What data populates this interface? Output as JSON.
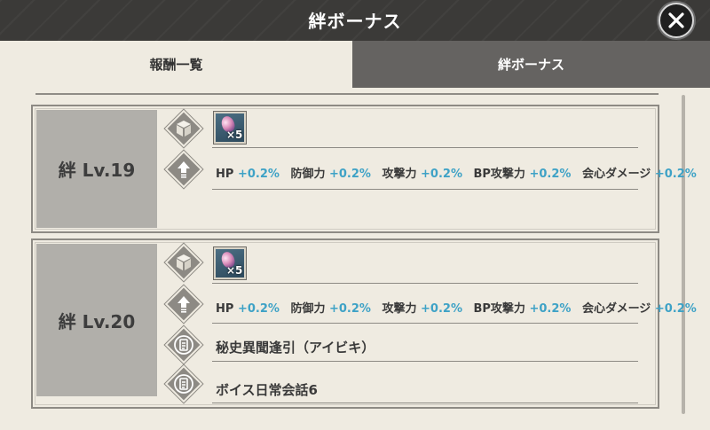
{
  "header": {
    "title": "絆ボーナス",
    "close_label": "close"
  },
  "tabs": [
    {
      "label": "報酬一覧",
      "active": true
    },
    {
      "label": "絆ボーナス",
      "active": false
    }
  ],
  "colors": {
    "titlebar": "#3b3a38",
    "inactive_tab": "#656361",
    "bonus_value": "#3ea2c6",
    "background": "#efebe1"
  },
  "cards": [
    {
      "level_label": "絆 Lv.19",
      "item_reward": {
        "icon": "gem-item-icon",
        "quantity": "×5"
      },
      "bonuses": [
        {
          "stat": "HP",
          "value": "+0.2%"
        },
        {
          "stat": "防御力",
          "value": "+0.2%"
        },
        {
          "stat": "攻撃力",
          "value": "+0.2%"
        },
        {
          "stat": "BP攻撃力",
          "value": "+0.2%"
        },
        {
          "stat": "会心ダメージ",
          "value": "+0.2%"
        }
      ],
      "text_rewards": []
    },
    {
      "level_label": "絆 Lv.20",
      "item_reward": {
        "icon": "gem-item-icon",
        "quantity": "×5"
      },
      "bonuses": [
        {
          "stat": "HP",
          "value": "+0.2%"
        },
        {
          "stat": "防御力",
          "value": "+0.2%"
        },
        {
          "stat": "攻撃力",
          "value": "+0.2%"
        },
        {
          "stat": "BP攻撃力",
          "value": "+0.2%"
        },
        {
          "stat": "会心ダメージ",
          "value": "+0.2%"
        }
      ],
      "text_rewards": [
        {
          "label": "秘史異聞逢引（アイビキ）",
          "icon": "document-icon"
        },
        {
          "label": "ボイス日常会話6",
          "icon": "document-icon"
        }
      ]
    }
  ]
}
